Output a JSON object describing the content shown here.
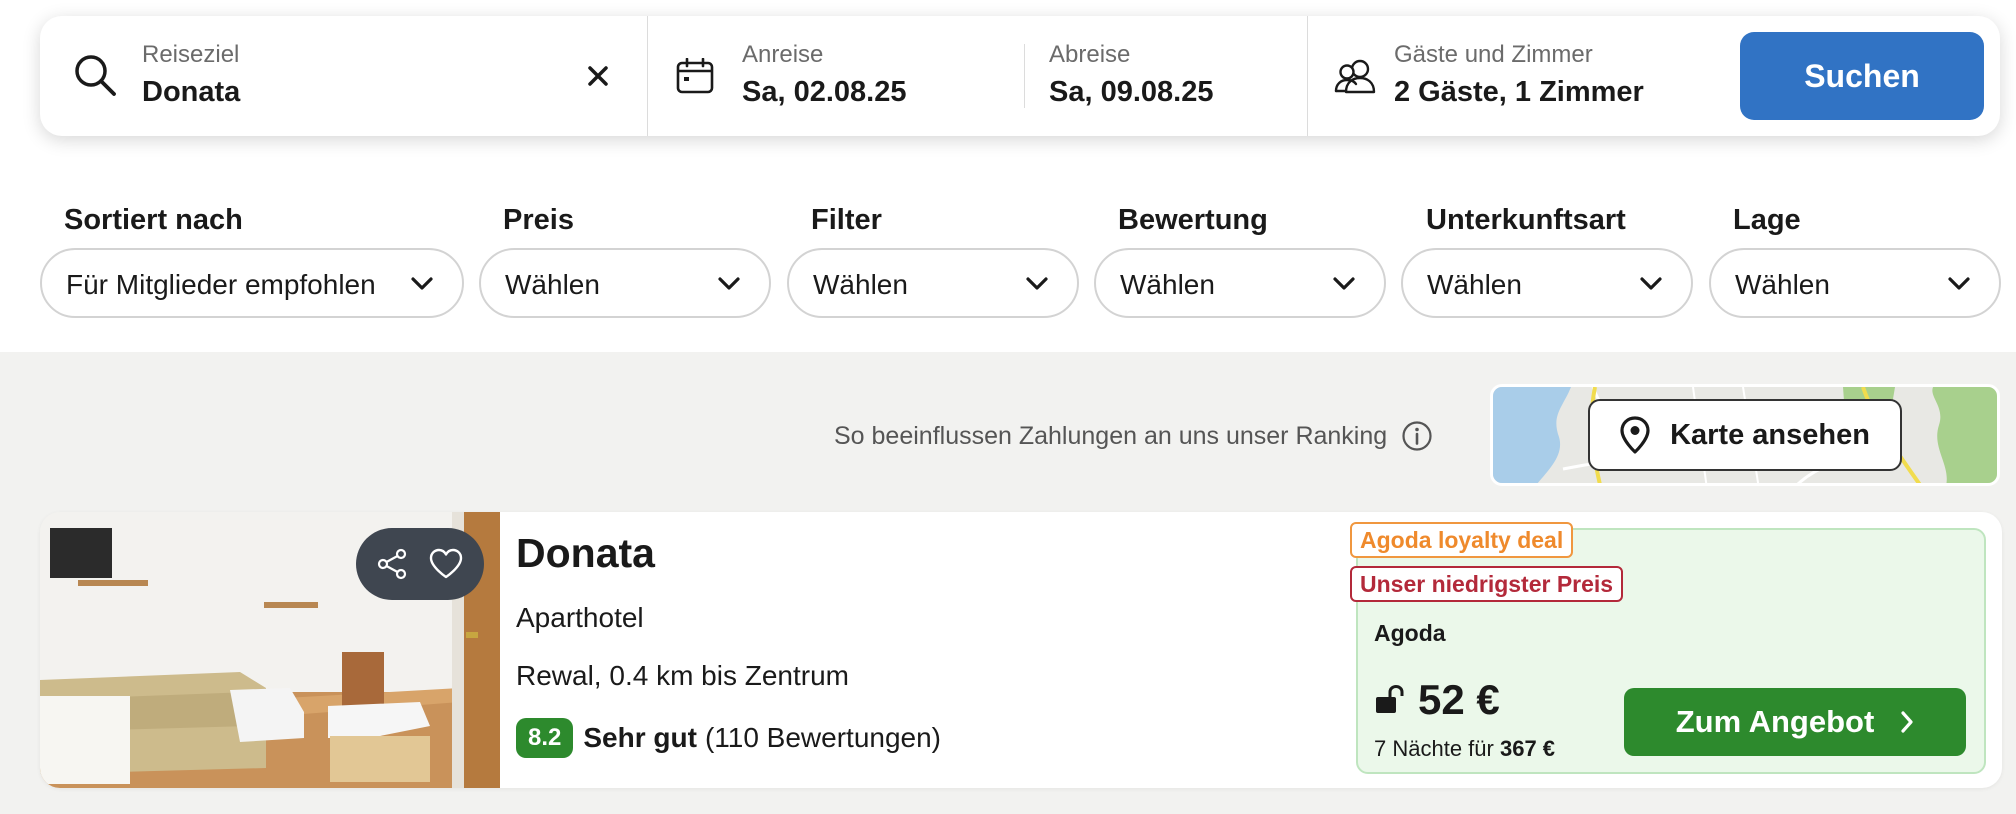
{
  "search": {
    "destination": {
      "label": "Reiseziel",
      "value": "Donata",
      "icon": "search-icon",
      "clear_icon": "close-icon"
    },
    "checkin": {
      "label": "Anreise",
      "value": "Sa, 02.08.25",
      "icon": "calendar-icon"
    },
    "checkout": {
      "label": "Abreise",
      "value": "Sa, 09.08.25"
    },
    "guests": {
      "label": "Gäste und Zimmer",
      "value": "2 Gäste, 1 Zimmer",
      "icon": "users-icon"
    },
    "button_label": "Suchen",
    "button_color": "#3173c4"
  },
  "filters": [
    {
      "label": "Sortiert nach",
      "value": "Für Mitglieder empfohlen"
    },
    {
      "label": "Preis",
      "value": "Wählen"
    },
    {
      "label": "Filter",
      "value": "Wählen"
    },
    {
      "label": "Bewertung",
      "value": "Wählen"
    },
    {
      "label": "Unterkunftsart",
      "value": "Wählen"
    },
    {
      "label": "Lage",
      "value": "Wählen"
    }
  ],
  "ranking_note": "So beeinflussen Zahlungen an uns unser Ranking",
  "map": {
    "button_label": "Karte ansehen",
    "icon": "map-pin-icon"
  },
  "hotel": {
    "name": "Donata",
    "type": "Aparthotel",
    "location": "Rewal, 0.4 km bis Zentrum",
    "score": "8.2",
    "rating_word": "Sehr gut",
    "reviews": "(110 Bewertungen)",
    "actions": [
      "share-icon",
      "heart-icon"
    ],
    "tags": {
      "deal": "Agoda loyalty deal",
      "lowest": "Unser niedrigster Preis"
    },
    "offer": {
      "provider": "Agoda",
      "price": "52 €",
      "nights_text": "7 Nächte für",
      "total": "367 €",
      "cta_label": "Zum Angebot",
      "icon": "unlock-icon"
    },
    "accent_green": "#2d8a2d"
  }
}
